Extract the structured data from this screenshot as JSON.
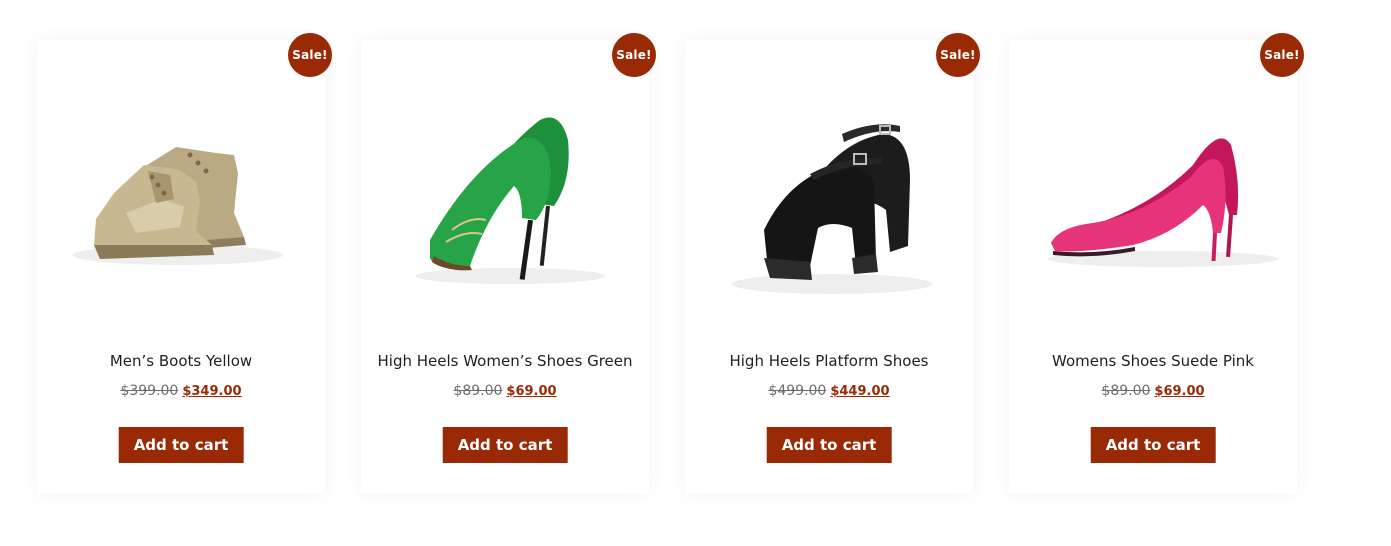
{
  "colors": {
    "accent": "#9a2a05",
    "title_text": "#1f1f1f",
    "old_price_text": "#6f6f6f"
  },
  "products": [
    {
      "badge": "Sale!",
      "title": "Men’s Boots Yellow",
      "old_price": "$399.00",
      "new_price": "$349.00",
      "button": "Add to cart",
      "image_icon": "tan-boots-image"
    },
    {
      "badge": "Sale!",
      "title": "High Heels Women’s Shoes Green",
      "old_price": "$89.00",
      "new_price": "$69.00",
      "button": "Add to cart",
      "image_icon": "green-heels-image"
    },
    {
      "badge": "Sale!",
      "title": "High Heels Platform Shoes",
      "old_price": "$499.00",
      "new_price": "$449.00",
      "button": "Add to cart",
      "image_icon": "black-platform-image"
    },
    {
      "badge": "Sale!",
      "title": "Womens Shoes Suede Pink",
      "old_price": "$89.00",
      "new_price": "$69.00",
      "button": "Add to cart",
      "image_icon": "pink-heels-image"
    }
  ]
}
